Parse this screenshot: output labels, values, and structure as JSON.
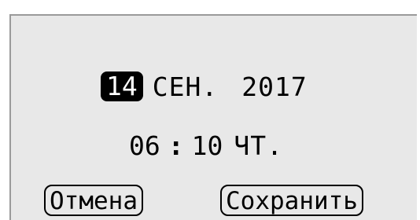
{
  "date": {
    "day": "14",
    "month": "СЕН.",
    "year": "2017"
  },
  "time": {
    "hours": "06",
    "separator": ":",
    "minutes": "10",
    "weekday": "ЧТ."
  },
  "buttons": {
    "cancel_label": "Отмена",
    "save_label": "Сохранить"
  }
}
